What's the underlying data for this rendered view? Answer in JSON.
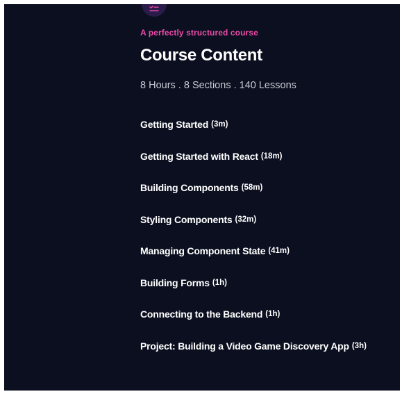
{
  "course": {
    "icon": "list-check-icon",
    "eyebrow": "A perfectly structured course",
    "title": "Course Content",
    "meta": "8 Hours . 8 Sections . 140 Lessons",
    "sections": [
      {
        "title": "Getting Started",
        "duration": "(3m)"
      },
      {
        "title": "Getting Started with React",
        "duration": "(18m)"
      },
      {
        "title": "Building Components",
        "duration": "(58m)"
      },
      {
        "title": "Styling Components",
        "duration": "(32m)"
      },
      {
        "title": "Managing Component State",
        "duration": "(41m)"
      },
      {
        "title": "Building Forms",
        "duration": "(1h)"
      },
      {
        "title": "Connecting to the Backend",
        "duration": "(1h)"
      },
      {
        "title": "Project: Building a Video Game Discovery App",
        "duration": "(3h)"
      }
    ]
  },
  "colors": {
    "background": "#0b0f1f",
    "accent": "#ec4aa8",
    "icon_badge": "#2a1c4a",
    "meta_text": "#c7cbd6"
  }
}
